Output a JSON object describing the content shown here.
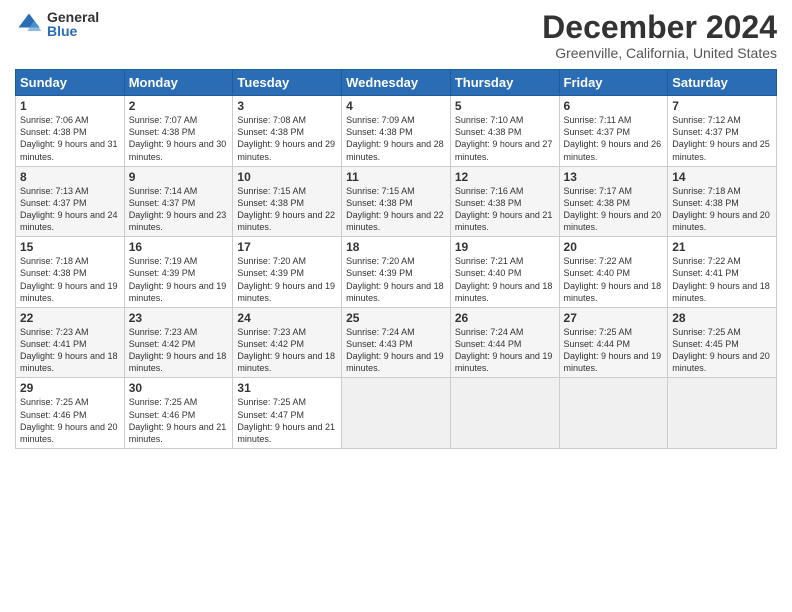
{
  "logo": {
    "general": "General",
    "blue": "Blue"
  },
  "title": "December 2024",
  "subtitle": "Greenville, California, United States",
  "headers": [
    "Sunday",
    "Monday",
    "Tuesday",
    "Wednesday",
    "Thursday",
    "Friday",
    "Saturday"
  ],
  "weeks": [
    [
      {
        "day": "1",
        "sunrise": "7:06 AM",
        "sunset": "4:38 PM",
        "daylight": "9 hours and 31 minutes."
      },
      {
        "day": "2",
        "sunrise": "7:07 AM",
        "sunset": "4:38 PM",
        "daylight": "9 hours and 30 minutes."
      },
      {
        "day": "3",
        "sunrise": "7:08 AM",
        "sunset": "4:38 PM",
        "daylight": "9 hours and 29 minutes."
      },
      {
        "day": "4",
        "sunrise": "7:09 AM",
        "sunset": "4:38 PM",
        "daylight": "9 hours and 28 minutes."
      },
      {
        "day": "5",
        "sunrise": "7:10 AM",
        "sunset": "4:38 PM",
        "daylight": "9 hours and 27 minutes."
      },
      {
        "day": "6",
        "sunrise": "7:11 AM",
        "sunset": "4:37 PM",
        "daylight": "9 hours and 26 minutes."
      },
      {
        "day": "7",
        "sunrise": "7:12 AM",
        "sunset": "4:37 PM",
        "daylight": "9 hours and 25 minutes."
      }
    ],
    [
      {
        "day": "8",
        "sunrise": "7:13 AM",
        "sunset": "4:37 PM",
        "daylight": "9 hours and 24 minutes."
      },
      {
        "day": "9",
        "sunrise": "7:14 AM",
        "sunset": "4:37 PM",
        "daylight": "9 hours and 23 minutes."
      },
      {
        "day": "10",
        "sunrise": "7:15 AM",
        "sunset": "4:38 PM",
        "daylight": "9 hours and 22 minutes."
      },
      {
        "day": "11",
        "sunrise": "7:15 AM",
        "sunset": "4:38 PM",
        "daylight": "9 hours and 22 minutes."
      },
      {
        "day": "12",
        "sunrise": "7:16 AM",
        "sunset": "4:38 PM",
        "daylight": "9 hours and 21 minutes."
      },
      {
        "day": "13",
        "sunrise": "7:17 AM",
        "sunset": "4:38 PM",
        "daylight": "9 hours and 20 minutes."
      },
      {
        "day": "14",
        "sunrise": "7:18 AM",
        "sunset": "4:38 PM",
        "daylight": "9 hours and 20 minutes."
      }
    ],
    [
      {
        "day": "15",
        "sunrise": "7:18 AM",
        "sunset": "4:38 PM",
        "daylight": "9 hours and 19 minutes."
      },
      {
        "day": "16",
        "sunrise": "7:19 AM",
        "sunset": "4:39 PM",
        "daylight": "9 hours and 19 minutes."
      },
      {
        "day": "17",
        "sunrise": "7:20 AM",
        "sunset": "4:39 PM",
        "daylight": "9 hours and 19 minutes."
      },
      {
        "day": "18",
        "sunrise": "7:20 AM",
        "sunset": "4:39 PM",
        "daylight": "9 hours and 18 minutes."
      },
      {
        "day": "19",
        "sunrise": "7:21 AM",
        "sunset": "4:40 PM",
        "daylight": "9 hours and 18 minutes."
      },
      {
        "day": "20",
        "sunrise": "7:22 AM",
        "sunset": "4:40 PM",
        "daylight": "9 hours and 18 minutes."
      },
      {
        "day": "21",
        "sunrise": "7:22 AM",
        "sunset": "4:41 PM",
        "daylight": "9 hours and 18 minutes."
      }
    ],
    [
      {
        "day": "22",
        "sunrise": "7:23 AM",
        "sunset": "4:41 PM",
        "daylight": "9 hours and 18 minutes."
      },
      {
        "day": "23",
        "sunrise": "7:23 AM",
        "sunset": "4:42 PM",
        "daylight": "9 hours and 18 minutes."
      },
      {
        "day": "24",
        "sunrise": "7:23 AM",
        "sunset": "4:42 PM",
        "daylight": "9 hours and 18 minutes."
      },
      {
        "day": "25",
        "sunrise": "7:24 AM",
        "sunset": "4:43 PM",
        "daylight": "9 hours and 19 minutes."
      },
      {
        "day": "26",
        "sunrise": "7:24 AM",
        "sunset": "4:44 PM",
        "daylight": "9 hours and 19 minutes."
      },
      {
        "day": "27",
        "sunrise": "7:25 AM",
        "sunset": "4:44 PM",
        "daylight": "9 hours and 19 minutes."
      },
      {
        "day": "28",
        "sunrise": "7:25 AM",
        "sunset": "4:45 PM",
        "daylight": "9 hours and 20 minutes."
      }
    ],
    [
      {
        "day": "29",
        "sunrise": "7:25 AM",
        "sunset": "4:46 PM",
        "daylight": "9 hours and 20 minutes."
      },
      {
        "day": "30",
        "sunrise": "7:25 AM",
        "sunset": "4:46 PM",
        "daylight": "9 hours and 21 minutes."
      },
      {
        "day": "31",
        "sunrise": "7:25 AM",
        "sunset": "4:47 PM",
        "daylight": "9 hours and 21 minutes."
      },
      null,
      null,
      null,
      null
    ]
  ],
  "labels": {
    "sunrise": "Sunrise:",
    "sunset": "Sunset:",
    "daylight": "Daylight:"
  },
  "colors": {
    "header_bg": "#2a6db5",
    "accent": "#2a6db5"
  }
}
